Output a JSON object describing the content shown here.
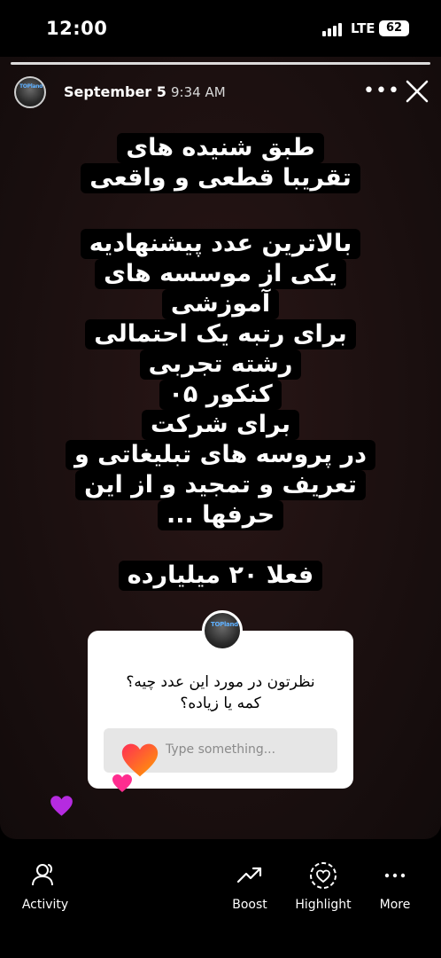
{
  "status_bar": {
    "time": "12:00",
    "network": "LTE",
    "battery": "62"
  },
  "story_header": {
    "date": "September 5",
    "time": "9:34 AM",
    "more_icon": "more-dots-icon",
    "close_icon": "close-icon"
  },
  "avatar_tag": "TOPland",
  "story_text": {
    "lines": [
      "طبق شنیده های",
      "تقریبا قطعی و واقعی",
      "بالاترین عدد پیشنهادیه",
      "یکی از موسسه های",
      "آموزشی",
      "برای رتبه یک احتمالی",
      "رشته تجربی",
      "کنکور ۰۵",
      "برای شرکت",
      "در پروسه های تبلیغاتی و",
      "تعریف و تمجید و از این",
      "حرفها ..."
    ],
    "final_line": "فعلا ۲۰ میلیارده"
  },
  "question_sticker": {
    "question_line1": "نظرتون در مورد این عدد چیه؟",
    "question_line2": "کمه یا زیاده؟",
    "input_placeholder": "Type something..."
  },
  "bottom_nav": {
    "activity": "Activity",
    "boost": "Boost",
    "highlight": "Highlight",
    "more": "More"
  },
  "colors": {
    "heart_orange": "#ff6a00",
    "heart_pink": "#ff2d8f",
    "heart_purple": "#b52be0"
  }
}
